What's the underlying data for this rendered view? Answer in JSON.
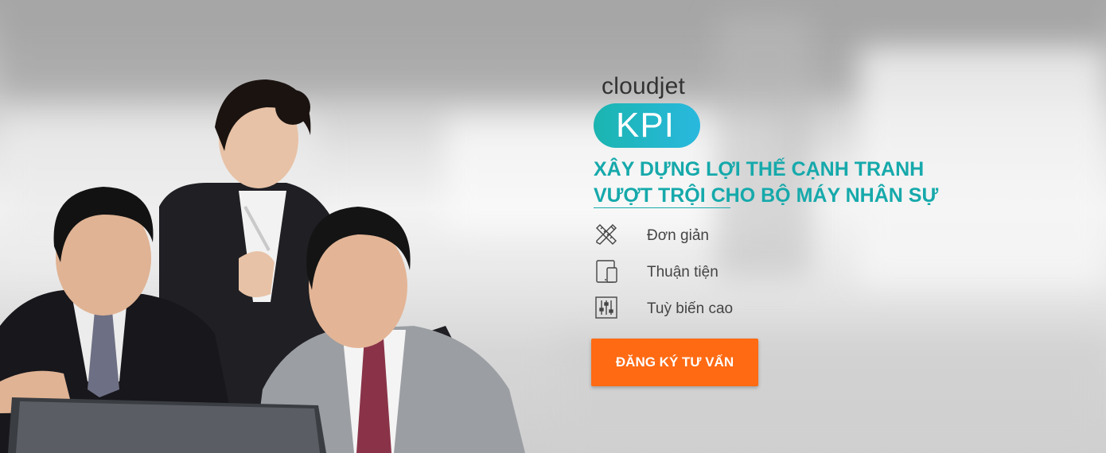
{
  "brand": {
    "name": "cloudjet",
    "product": "KPI"
  },
  "headline": {
    "line1": "XÂY DỰNG LỢI THẾ CẠNH TRANH",
    "line2": "VƯỢT TRỘI CHO BỘ MÁY NHÂN SỰ"
  },
  "features": [
    {
      "icon": "pencil-ruler-icon",
      "label": "Đơn giản"
    },
    {
      "icon": "devices-icon",
      "label": "Thuận tiện"
    },
    {
      "icon": "sliders-icon",
      "label": "Tuỳ biến cao"
    }
  ],
  "cta": {
    "label": "ĐĂNG KÝ TƯ VẤN"
  },
  "colors": {
    "accent": "#16a9ab",
    "pill_start": "#1bb5b0",
    "pill_end": "#29b8de",
    "cta": "#ff6a13"
  }
}
